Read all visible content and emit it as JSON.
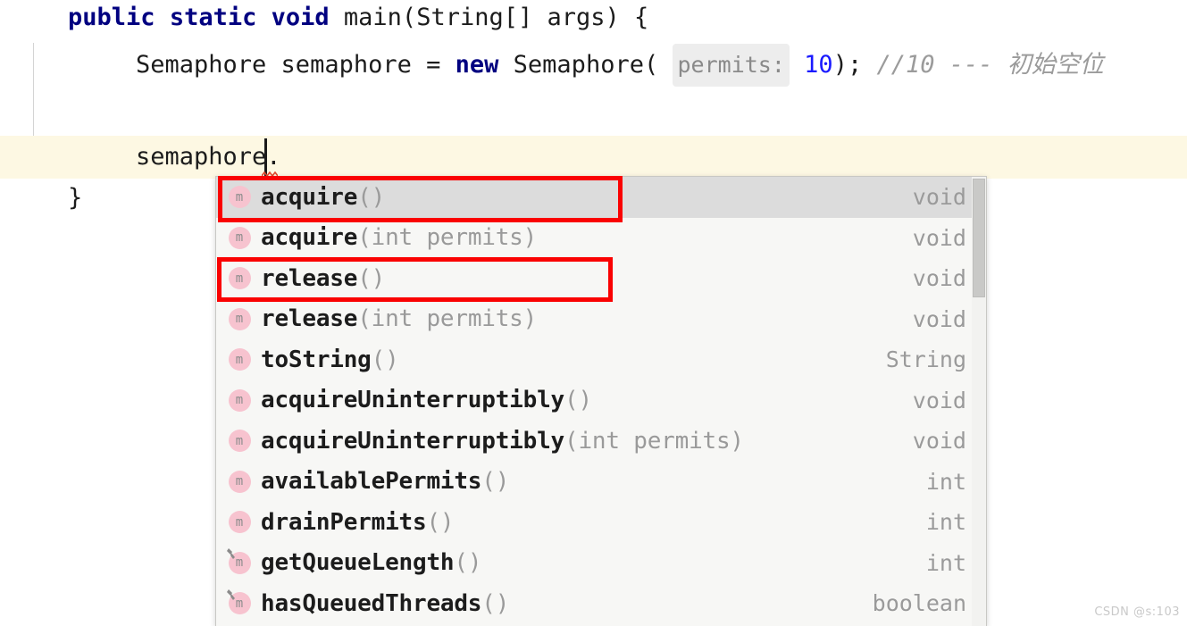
{
  "editor": {
    "lines": [
      {
        "id": "line1",
        "indent": 0,
        "segments": [
          {
            "kind": "keyword",
            "text": "public"
          },
          {
            "kind": "plain",
            "text": " "
          },
          {
            "kind": "keyword",
            "text": "static"
          },
          {
            "kind": "plain",
            "text": " "
          },
          {
            "kind": "keyword",
            "text": "void"
          },
          {
            "kind": "plain",
            "text": " main(String[] args) {"
          }
        ],
        "full_text": "public static void main(String[] args) {"
      },
      {
        "id": "line2",
        "indent": 1,
        "full_text": "Semaphore semaphore = new Semaphore( permits: 10); //10 --- 初始空位"
      },
      {
        "id": "line3",
        "indent": 1,
        "full_text": "semaphore."
      },
      {
        "id": "line4",
        "indent": 0,
        "full_text": "}"
      }
    ],
    "line1": {
      "kw_public": "public",
      "kw_static": "static",
      "kw_void": "void",
      "rest": " main(String[] args) {"
    },
    "line2": {
      "type_name": "Semaphore semaphore = ",
      "kw_new": "new",
      "ctor": " Semaphore(",
      "param_hint": "permits:",
      "arg_value": "10",
      "close": ");",
      "comment": "//10 ---",
      "comment_cjk": "初始空位"
    },
    "line3": {
      "text": "semaphore."
    },
    "line4": {
      "text": "}"
    }
  },
  "completion_popup": {
    "selected_index": 0,
    "icon_letter": "m",
    "items": [
      {
        "name": "acquire",
        "params": "()",
        "type": "void",
        "selected": true,
        "protected": false
      },
      {
        "name": "acquire",
        "params": "(int permits)",
        "type": "void",
        "selected": false,
        "protected": false
      },
      {
        "name": "release",
        "params": "()",
        "type": "void",
        "selected": false,
        "protected": false
      },
      {
        "name": "release",
        "params": "(int permits)",
        "type": "void",
        "selected": false,
        "protected": false
      },
      {
        "name": "toString",
        "params": "()",
        "type": "String",
        "selected": false,
        "protected": false
      },
      {
        "name": "acquireUninterruptibly",
        "params": "()",
        "type": "void",
        "selected": false,
        "protected": false
      },
      {
        "name": "acquireUninterruptibly",
        "params": "(int permits)",
        "type": "void",
        "selected": false,
        "protected": false
      },
      {
        "name": "availablePermits",
        "params": "()",
        "type": "int",
        "selected": false,
        "protected": false
      },
      {
        "name": "drainPermits",
        "params": "()",
        "type": "int",
        "selected": false,
        "protected": false
      },
      {
        "name": "getQueueLength",
        "params": "()",
        "type": "int",
        "selected": false,
        "protected": true
      },
      {
        "name": "hasQueuedThreads",
        "params": "()",
        "type": "boolean",
        "selected": false,
        "protected": true
      }
    ]
  },
  "annotations": [
    {
      "id": "annot-acquire",
      "target": "acquire()",
      "color": "#fa0202"
    },
    {
      "id": "annot-release",
      "target": "release()",
      "color": "#fa0202"
    }
  ],
  "watermark": {
    "text": "CSDN @s:103"
  },
  "colors": {
    "keyword": "#000080",
    "number": "#1a1aff",
    "comment": "#9b9b9b",
    "current_line_bg": "#fdf8e3",
    "selected_row_bg": "#dcdcdc",
    "popup_bg": "#f7f7f5",
    "icon_pink": "#f7c3cf",
    "annotation_red": "#fa0202"
  }
}
